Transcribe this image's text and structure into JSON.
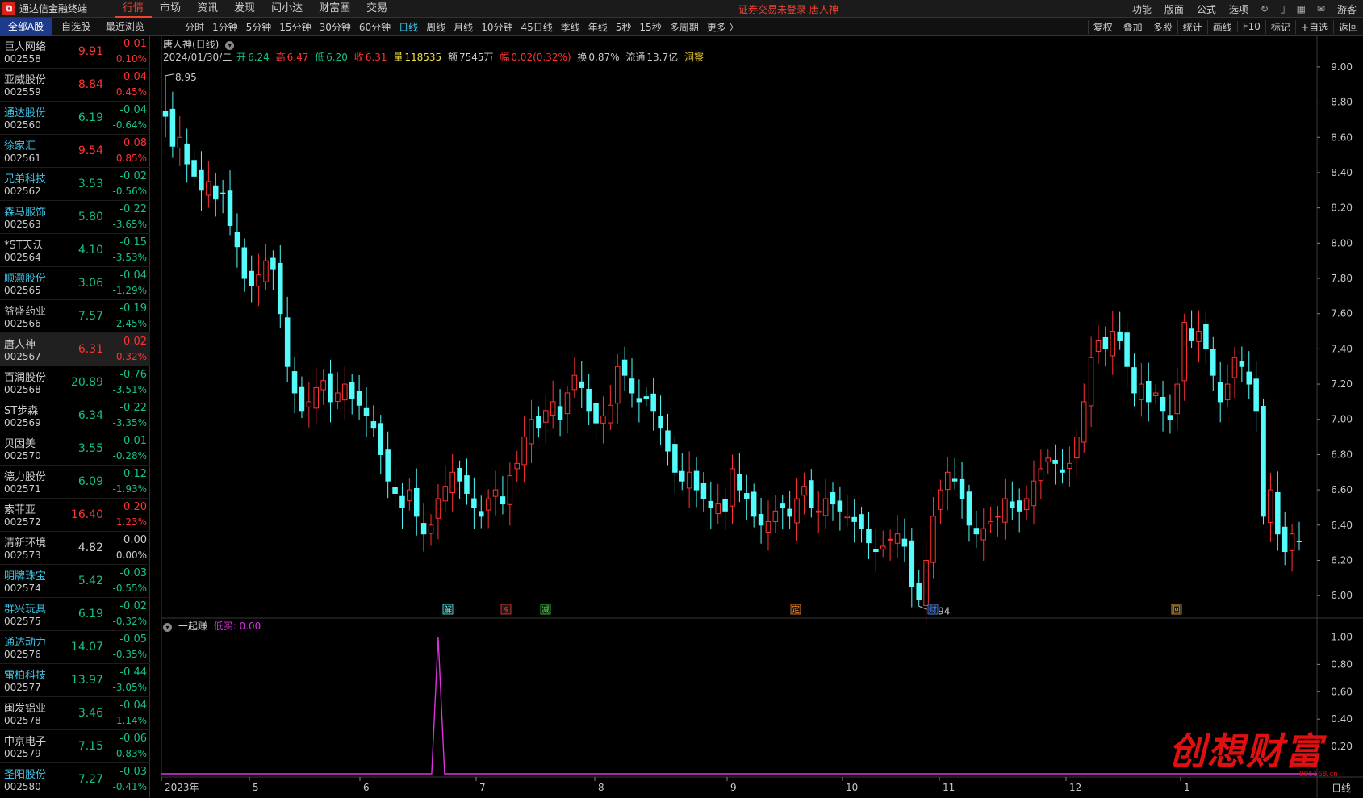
{
  "app": {
    "title": "通达信金融终端",
    "logo": "tdx-logo"
  },
  "menu": [
    "行情",
    "市场",
    "资讯",
    "发现",
    "问小达",
    "财富圈",
    "交易"
  ],
  "menu_active": 0,
  "login_status": "证券交易未登录  唐人神",
  "right_menu": [
    "功能",
    "版面",
    "公式",
    "选项"
  ],
  "right_icons": [
    "refresh-icon",
    "phone-icon",
    "grid-icon",
    "mail-icon"
  ],
  "user": "游客",
  "list_tabs": [
    "全部A股",
    "自选股",
    "最近浏览"
  ],
  "period_tabs": [
    "分时",
    "1分钟",
    "5分钟",
    "15分钟",
    "30分钟",
    "60分钟",
    "日线",
    "周线",
    "月线",
    "10分钟",
    "45日线",
    "季线",
    "年线",
    "5秒",
    "15秒",
    "多周期",
    "更多 〉"
  ],
  "period_active": 6,
  "tool_tabs": [
    "复权",
    "叠加",
    "多股",
    "统计",
    "画线",
    "F10",
    "标记",
    "+自选",
    "返回"
  ],
  "stocks": [
    {
      "name": "巨人网络",
      "code": "002558",
      "price": "9.91",
      "chg": "0.01",
      "pct": "0.10%",
      "dir": "up",
      "tag": "plain"
    },
    {
      "name": "亚威股份",
      "code": "002559",
      "price": "8.84",
      "chg": "0.04",
      "pct": "0.45%",
      "dir": "up",
      "tag": "plain"
    },
    {
      "name": "通达股份",
      "code": "002560",
      "price": "6.19",
      "chg": "-0.04",
      "pct": "-0.64%",
      "dir": "down",
      "tag": "hl"
    },
    {
      "name": "徐家汇",
      "code": "002561",
      "price": "9.54",
      "chg": "0.08",
      "pct": "0.85%",
      "dir": "up",
      "tag": "hl"
    },
    {
      "name": "兄弟科技",
      "code": "002562",
      "price": "3.53",
      "chg": "-0.02",
      "pct": "-0.56%",
      "dir": "down",
      "tag": "hl"
    },
    {
      "name": "森马服饰",
      "code": "002563",
      "price": "5.80",
      "chg": "-0.22",
      "pct": "-3.65%",
      "dir": "down",
      "tag": "hl"
    },
    {
      "name": "*ST天沃",
      "code": "002564",
      "price": "4.10",
      "chg": "-0.15",
      "pct": "-3.53%",
      "dir": "down",
      "tag": "plain"
    },
    {
      "name": "顺灏股份",
      "code": "002565",
      "price": "3.06",
      "chg": "-0.04",
      "pct": "-1.29%",
      "dir": "down",
      "tag": "hl"
    },
    {
      "name": "益盛药业",
      "code": "002566",
      "price": "7.57",
      "chg": "-0.19",
      "pct": "-2.45%",
      "dir": "down",
      "tag": "plain"
    },
    {
      "name": "唐人神",
      "code": "002567",
      "price": "6.31",
      "chg": "0.02",
      "pct": "0.32%",
      "dir": "up",
      "tag": "plain",
      "selected": true
    },
    {
      "name": "百润股份",
      "code": "002568",
      "price": "20.89",
      "chg": "-0.76",
      "pct": "-3.51%",
      "dir": "down",
      "tag": "plain"
    },
    {
      "name": "ST步森",
      "code": "002569",
      "price": "6.34",
      "chg": "-0.22",
      "pct": "-3.35%",
      "dir": "down",
      "tag": "plain"
    },
    {
      "name": "贝因美",
      "code": "002570",
      "price": "3.55",
      "chg": "-0.01",
      "pct": "-0.28%",
      "dir": "down",
      "tag": "plain"
    },
    {
      "name": "德力股份",
      "code": "002571",
      "price": "6.09",
      "chg": "-0.12",
      "pct": "-1.93%",
      "dir": "down",
      "tag": "plain"
    },
    {
      "name": "索菲亚",
      "code": "002572",
      "price": "16.40",
      "chg": "0.20",
      "pct": "1.23%",
      "dir": "up",
      "tag": "plain"
    },
    {
      "name": "清新环境",
      "code": "002573",
      "price": "4.82",
      "chg": "0.00",
      "pct": "0.00%",
      "dir": "flat",
      "tag": "plain"
    },
    {
      "name": "明牌珠宝",
      "code": "002574",
      "price": "5.42",
      "chg": "-0.03",
      "pct": "-0.55%",
      "dir": "down",
      "tag": "hl"
    },
    {
      "name": "群兴玩具",
      "code": "002575",
      "price": "6.19",
      "chg": "-0.02",
      "pct": "-0.32%",
      "dir": "down",
      "tag": "hl"
    },
    {
      "name": "通达动力",
      "code": "002576",
      "price": "14.07",
      "chg": "-0.05",
      "pct": "-0.35%",
      "dir": "down",
      "tag": "hl"
    },
    {
      "name": "雷柏科技",
      "code": "002577",
      "price": "13.97",
      "chg": "-0.44",
      "pct": "-3.05%",
      "dir": "down",
      "tag": "hl"
    },
    {
      "name": "闽发铝业",
      "code": "002578",
      "price": "3.46",
      "chg": "-0.04",
      "pct": "-1.14%",
      "dir": "down",
      "tag": "plain"
    },
    {
      "name": "中京电子",
      "code": "002579",
      "price": "7.15",
      "chg": "-0.06",
      "pct": "-0.83%",
      "dir": "down",
      "tag": "plain"
    },
    {
      "name": "圣阳股份",
      "code": "002580",
      "price": "7.27",
      "chg": "-0.03",
      "pct": "-0.41%",
      "dir": "down",
      "tag": "hl"
    }
  ],
  "chart_header": {
    "title": "唐人神(日线)"
  },
  "ohlc": {
    "date": "2024/01/30/二",
    "open_label": "开",
    "open": "6.24",
    "high_label": "高",
    "high": "6.47",
    "low_label": "低",
    "low": "6.20",
    "close_label": "收",
    "close": "6.31",
    "vol_label": "量",
    "vol": "118535",
    "amt_label": "额",
    "amt": "7545万",
    "range_label": "幅",
    "range": "0.02(0.32%)",
    "turn_label": "换",
    "turn": "0.87%",
    "float_label": "流通",
    "float": "13.7亿",
    "extra": "洞察"
  },
  "indicator": {
    "name": "一起赚",
    "label": "低买: 0.00"
  },
  "period_label": "日线",
  "watermark": "创想财富",
  "watermark_url": "995168.cn",
  "colors": {
    "up": "#ff3232",
    "down": "#54fcfc",
    "indicator": "#e030e0",
    "axis": "#c8c8c8"
  },
  "chart_data": [
    {
      "type": "candlestick",
      "title": "唐人神(日线)",
      "ylim": [
        5.9,
        9.05
      ],
      "yticks": [
        6.0,
        6.2,
        6.4,
        6.6,
        6.8,
        7.0,
        7.2,
        7.4,
        7.6,
        7.8,
        8.0,
        8.2,
        8.4,
        8.6,
        8.8,
        9.0
      ],
      "x_tick_labels": [
        "2023年",
        "5",
        "6",
        "7",
        "8",
        "9",
        "10",
        "11",
        "12",
        "1"
      ],
      "annotations": [
        {
          "text": "8.95",
          "type": "high"
        },
        {
          "text": "5.94",
          "type": "low"
        }
      ],
      "event_markers": [
        "解",
        "$",
        "减",
        "定",
        "财",
        "回"
      ],
      "close_series": [
        8.72,
        8.55,
        8.6,
        8.45,
        8.38,
        8.3,
        8.35,
        8.25,
        8.28,
        8.1,
        7.98,
        7.8,
        7.76,
        7.82,
        7.9,
        7.85,
        7.6,
        7.3,
        7.15,
        7.05,
        7.1,
        7.18,
        7.22,
        7.1,
        7.15,
        7.2,
        7.12,
        7.08,
        7.02,
        6.95,
        6.8,
        6.65,
        6.58,
        6.5,
        6.6,
        6.45,
        6.35,
        6.4,
        6.55,
        6.62,
        6.7,
        6.65,
        6.58,
        6.5,
        6.45,
        6.55,
        6.6,
        6.52,
        6.68,
        6.75,
        6.9,
        7.0,
        6.95,
        7.05,
        7.1,
        7.0,
        7.15,
        7.25,
        7.18,
        7.05,
        6.98,
        7.02,
        7.08,
        7.3,
        7.25,
        7.15,
        7.1,
        7.12,
        7.05,
        6.95,
        6.82,
        6.7,
        6.65,
        6.7,
        6.6,
        6.55,
        6.5,
        6.52,
        6.48,
        6.72,
        6.6,
        6.55,
        6.45,
        6.4,
        6.42,
        6.48,
        6.5,
        6.45,
        6.55,
        6.62,
        6.5,
        6.48,
        6.55,
        6.52,
        6.48,
        6.45,
        6.42,
        6.38,
        6.3,
        6.25,
        6.28,
        6.32,
        6.35,
        6.28,
        6.05,
        5.98,
        6.2,
        6.45,
        6.6,
        6.7,
        6.65,
        6.55,
        6.4,
        6.35,
        6.38,
        6.42,
        6.45,
        6.55,
        6.5,
        6.48,
        6.55,
        6.65,
        6.72,
        6.78,
        6.75,
        6.7,
        6.75,
        6.9,
        7.1,
        7.35,
        7.45,
        7.4,
        7.5,
        7.45,
        7.3,
        7.15,
        7.2,
        7.1,
        7.15,
        7.05,
        7.0,
        7.2,
        7.55,
        7.45,
        7.5,
        7.4,
        7.25,
        7.1,
        7.2,
        7.35,
        7.3,
        7.2,
        7.05,
        6.45,
        6.6,
        6.35,
        6.25,
        6.35,
        6.31
      ]
    },
    {
      "type": "line",
      "title": "一起赚",
      "ylim": [
        0,
        1.05
      ],
      "yticks": [
        0.2,
        0.4,
        0.6,
        0.8,
        1.0
      ],
      "series": [
        {
          "name": "低买",
          "spike_index": 38,
          "spike_value": 1.0
        }
      ]
    }
  ]
}
